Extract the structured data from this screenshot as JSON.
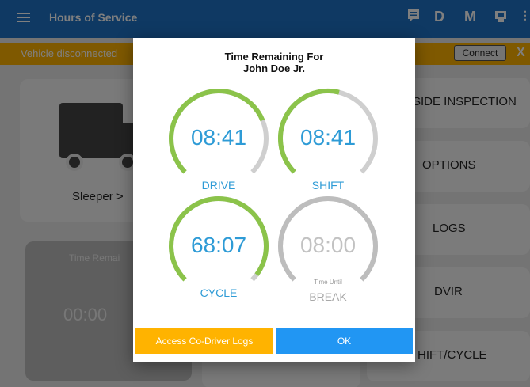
{
  "appbar": {
    "title": "Hours of Service",
    "actions": [
      "D",
      "M"
    ],
    "icons": [
      "message-icon",
      "printer-icon",
      "overflow-icon"
    ]
  },
  "banner": {
    "message": "Vehicle disconnected",
    "connect_label": "Connect",
    "close_label": "X"
  },
  "status_card": {
    "label": "Sleeper >"
  },
  "time_card": {
    "label": "Time Remai",
    "value": "00:00"
  },
  "menu": {
    "items": [
      "SIDE INSPECTION",
      "OPTIONS",
      "LOGS",
      "DVIR",
      "HIFT/CYCLE"
    ]
  },
  "dialog": {
    "title_line1": "Time Remaining For",
    "title_line2": "John Doe Jr.",
    "gauges": [
      {
        "value": "08:41",
        "label": "DRIVE",
        "fill": 0.75,
        "color": "#8bc34a"
      },
      {
        "value": "08:41",
        "label": "SHIFT",
        "fill": 0.55,
        "color": "#8bc34a"
      },
      {
        "value": "68:07",
        "label": "CYCLE",
        "fill": 0.97,
        "color": "#8bc34a"
      },
      {
        "value": "08:00",
        "label": "BREAK",
        "sublabel": "Time Until",
        "fill": 1.0,
        "color": "#bdbdbd"
      }
    ],
    "prev_arrow": "←",
    "next_arrow": "→",
    "codriver_label": "Access Co-Driver Logs",
    "ok_label": "OK"
  }
}
